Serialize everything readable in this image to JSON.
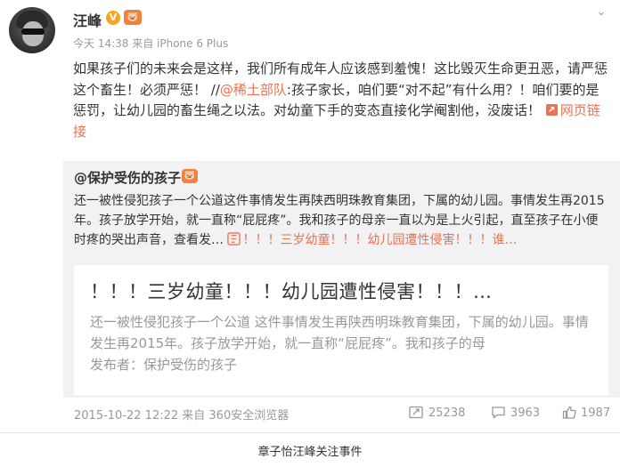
{
  "author": {
    "name": "汪峰",
    "verified_mark": "V",
    "member_badge": "🐷"
  },
  "meta": "今天 14:38 来自 iPhone 6 Plus",
  "post": {
    "text_before": "如果孩子们的未来会是这样，我们所有成年人应该感到羞愧！这比毁灭生命更丑恶，请严惩这个畜生！必须严惩！ //",
    "mention": "@稀土部队",
    "text_after": ":孩子家长，咱们要“对不起”有什么用？！咱们要的是惩罚，让幼儿园的畜生绳之以法。对幼童下手的变态直接化学阉割他，没废话！",
    "web_link": "网页链接"
  },
  "repost": {
    "author": "@保护受伤的孩子",
    "author_badge": "🐷",
    "text": "还一被性侵犯孩子一个公道这件事情发生再陕西明珠教育集团，下属的幼儿园。事情发生再2015年。孩子放学开始，就一直称“屁屁疼”。我和孩子的母亲一直以为是上火引起，直至孩子在小便时疼的哭出声音，查看发…",
    "link_text": "！！！三岁幼童！！！幼儿园遭性侵害！！！谁…",
    "card": {
      "title": "！！！三岁幼童！！！幼儿园遭性侵害！！！…",
      "summary": "还一被性侵犯孩子一个公道 这件事情发生再陕西明珠教育集团，下属的幼儿园。事情发生再2015年。孩子放学开始，就一直称“屁屁疼”。我和孩子的母",
      "publisher": "发布者：保护受伤的孩子"
    },
    "time": "2015-10-22 12:22 来自 360安全浏览器",
    "forwards": "25238",
    "comments": "3963",
    "likes": "1987"
  },
  "bottom_link": "章子怡汪峰关注事件",
  "colors": {
    "link": "#eb7350",
    "muted": "#999999",
    "repost_bg": "#f2f2f5",
    "badge_orange": "#f3813a",
    "verified_yellow": "#f5a623"
  },
  "icons": [
    "chevron-down-icon",
    "link-icon",
    "forward-icon",
    "comment-icon",
    "like-icon"
  ]
}
